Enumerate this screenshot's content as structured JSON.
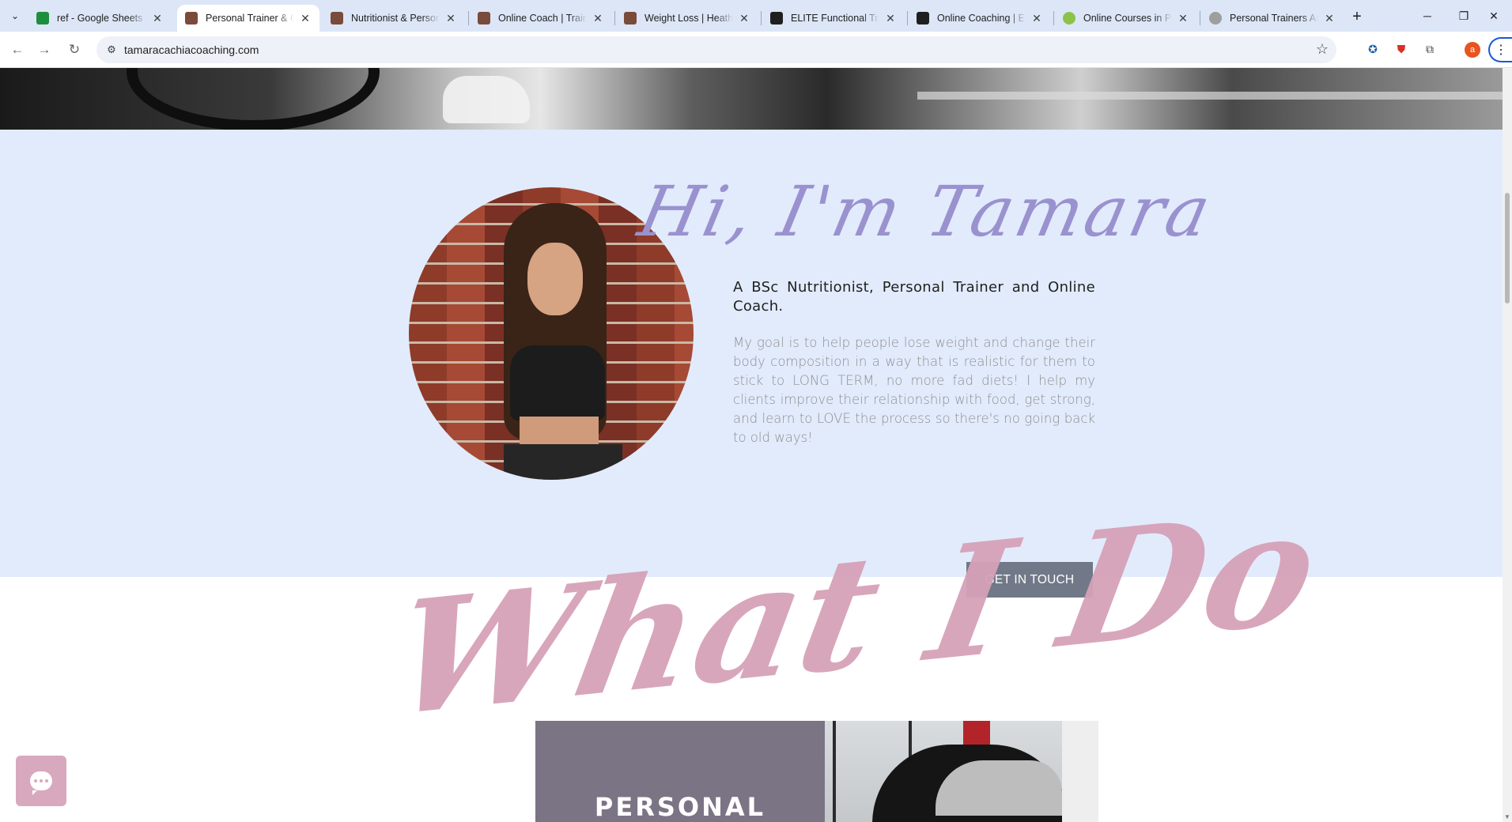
{
  "browser": {
    "tabs": [
      {
        "title": "ref - Google Sheets",
        "favicon": "google-sheets-icon",
        "color": "#1e8e3e",
        "active": false
      },
      {
        "title": "Personal Trainer & Online",
        "favicon": "site-favicon",
        "color": "#7a4a3a",
        "active": true
      },
      {
        "title": "Nutritionist & Personal",
        "favicon": "site-favicon",
        "color": "#7a4a3a",
        "active": false
      },
      {
        "title": "Online Coach | Trainer",
        "favicon": "site-favicon",
        "color": "#7a4a3a",
        "active": false
      },
      {
        "title": "Weight Loss | Heathy",
        "favicon": "site-favicon",
        "color": "#7a4a3a",
        "active": false
      },
      {
        "title": "ELITE Functional Training",
        "favicon": "elite-favicon",
        "color": "#1f1f1f",
        "active": false
      },
      {
        "title": "Online Coaching | Elite",
        "favicon": "elite-favicon",
        "color": "#1f1f1f",
        "active": false
      },
      {
        "title": "Online Courses in Personal",
        "favicon": "green-circle-favicon",
        "color": "#8bc34a",
        "active": false
      },
      {
        "title": "Personal Trainers Association",
        "favicon": "gauge-favicon",
        "color": "#9e9e9e",
        "active": false
      }
    ],
    "url": "tamaracachiacoaching.com",
    "profile_initial": "a"
  },
  "about": {
    "heading": "Hi, I'm Tamara",
    "subtitle": "A BSc Nutritionist, Personal Trainer and Online Coach.",
    "bio": "My goal is to help people lose weight and change their body composition in a way that is realistic for them to stick to LONG TERM, no more fad diets! I help my clients improve their relationship with food, get strong, and learn to LOVE the process so there's no going back to old ways!",
    "cta_label": "GET IN TOUCH"
  },
  "services": {
    "heading": "What I Do",
    "card_title": "PERSONAL"
  },
  "colors": {
    "about_bg": "#e2ebfc",
    "heading_accent": "#9a92cf",
    "what_accent": "#d6a2b8",
    "cta_bg": "#717989",
    "card_bg": "#7b7485",
    "chat_widget": "#d8a8be"
  }
}
